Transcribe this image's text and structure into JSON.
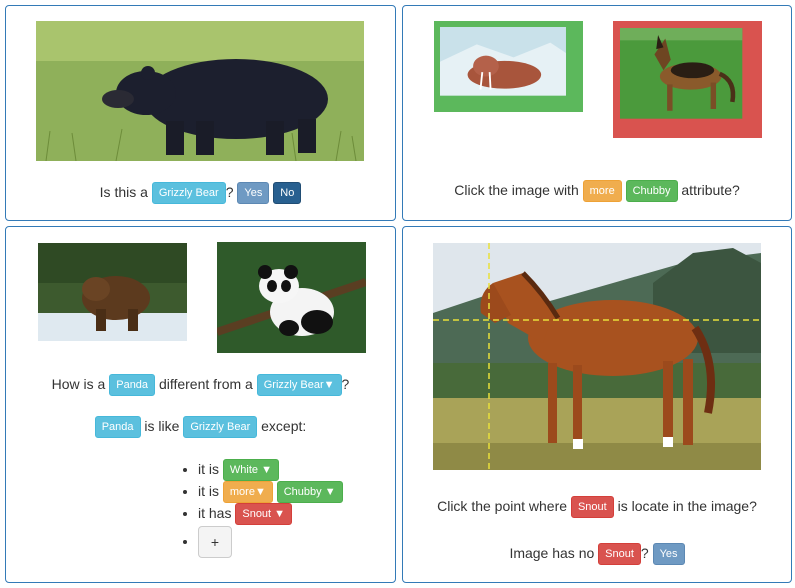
{
  "panel1": {
    "image_label": "black-bear-photo",
    "question_prefix": "Is this a",
    "class_tag": "Grizzly Bear",
    "question_suffix": "?",
    "yes_label": "Yes",
    "no_label": "No"
  },
  "panel2": {
    "left_image": "walrus-photo",
    "right_image": "german-shepherd-photo",
    "prompt_prefix": "Click the image with",
    "more_tag": "more",
    "attribute_tag": "Chubby",
    "prompt_suffix": "attribute?",
    "colors": {
      "correct_border": "#5cb85c",
      "wrong_border": "#d9534f"
    }
  },
  "panel3": {
    "left_image": "grizzly-bear-photo",
    "right_image": "panda-photo",
    "q_prefix": "How is a",
    "q_tag": "Panda",
    "q_middle": "different from a",
    "q_dropdown": "Grizzly Bear▼",
    "q_suffix": "?",
    "like_tag": "Panda",
    "like_middle": "is like",
    "like_dropdown": "Grizzly Bear",
    "like_suffix": "except:",
    "attrs": [
      {
        "prefix": "it is",
        "value": "White ▼"
      },
      {
        "prefix": "it is",
        "modifier": "more▼",
        "value": "Chubby ▼"
      },
      {
        "prefix": "it has",
        "value": "Snout ▼"
      }
    ],
    "add_label": "+"
  },
  "panel4": {
    "image": "horse-photo",
    "prompt_prefix": "Click the point where",
    "part_tag": "Snout",
    "prompt_suffix": "is locate in the image?",
    "no_part_prefix": "Image has no",
    "no_part_tag": "Snout",
    "no_part_q": "?",
    "yes_label": "Yes",
    "crosshair_color": "#e8e03a"
  }
}
